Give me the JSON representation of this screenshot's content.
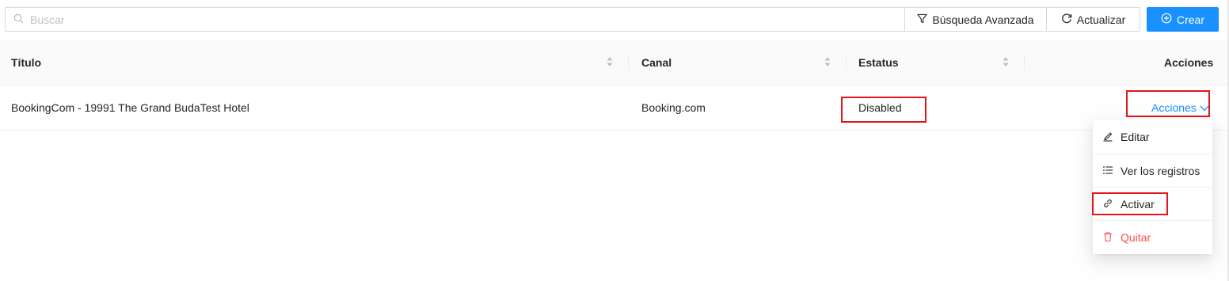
{
  "search": {
    "placeholder": "Buscar",
    "icon": "search-icon"
  },
  "toolbar": {
    "advanced_label": "Búsqueda Avanzada",
    "refresh_label": "Actualizar",
    "create_label": "Crear"
  },
  "table": {
    "columns": [
      "Título",
      "Canal",
      "Estatus",
      "Acciones"
    ],
    "rows": [
      {
        "title": "BookingCom - 19991 The Grand BudaTest Hotel",
        "channel": "Booking.com",
        "status": "Disabled",
        "actions_label": "Acciones"
      }
    ]
  },
  "menu": {
    "items": [
      {
        "label": "Editar",
        "icon": "edit-icon"
      },
      {
        "label": "Ver los registros",
        "icon": "list-icon"
      },
      {
        "label": "Activar",
        "icon": "link-icon"
      },
      {
        "label": "Quitar",
        "icon": "trash-icon"
      }
    ]
  },
  "colors": {
    "primary": "#1890ff",
    "danger": "#ff4d4f",
    "highlight": "#e3141c"
  }
}
